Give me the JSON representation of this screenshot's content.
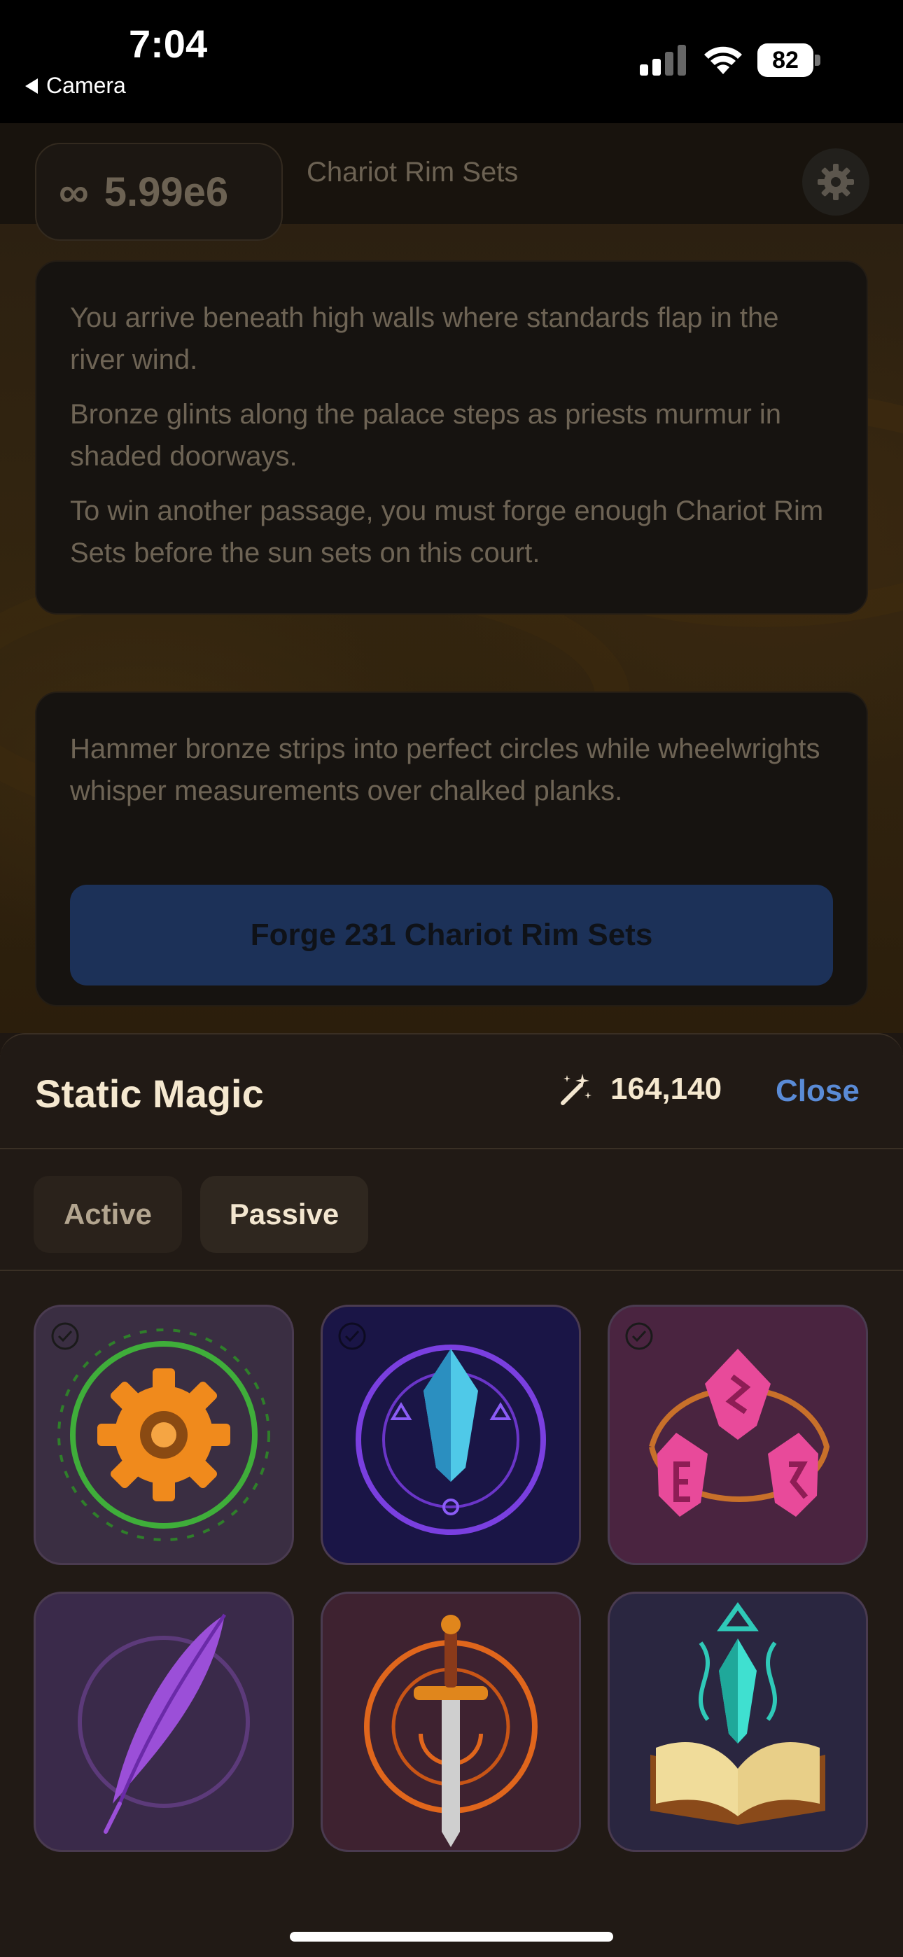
{
  "status_bar": {
    "time": "7:04",
    "back_label": "Camera",
    "battery": "82"
  },
  "header": {
    "counter_symbol": "∞",
    "counter_value": "5.99e6",
    "resource_name": "Chariot Rim Sets",
    "settings_icon": "gear-icon"
  },
  "story": {
    "paragraphs": [
      "You arrive beneath high walls where standards flap in the river wind.",
      "Bronze glints along the palace steps as priests murmur in shaded doorways.",
      "To win another passage, you must forge enough Chariot Rim Sets before the sun sets on this court."
    ]
  },
  "forge": {
    "description": "Hammer bronze strips into perfect circles while wheelwrights whisper measurements over chalked planks.",
    "button_label": "Forge 231 Chariot Rim Sets",
    "button_color": "#1c3158"
  },
  "sheet": {
    "title": "Static Magic",
    "mana_icon": "magic-wand-icon",
    "mana_value": "164,140",
    "close_label": "Close",
    "close_color": "#5a8bd6",
    "tabs": [
      {
        "label": "Active",
        "selected": false
      },
      {
        "label": "Passive",
        "selected": true
      }
    ],
    "spells": [
      {
        "icon": "gear-rune-icon",
        "checked": true
      },
      {
        "icon": "crystal-sigil-icon",
        "checked": true
      },
      {
        "icon": "pink-runestones-icon",
        "checked": true
      },
      {
        "icon": "purple-quill-icon",
        "checked": false
      },
      {
        "icon": "fire-sword-icon",
        "checked": false
      },
      {
        "icon": "crystal-spellbook-icon",
        "checked": false
      }
    ]
  }
}
